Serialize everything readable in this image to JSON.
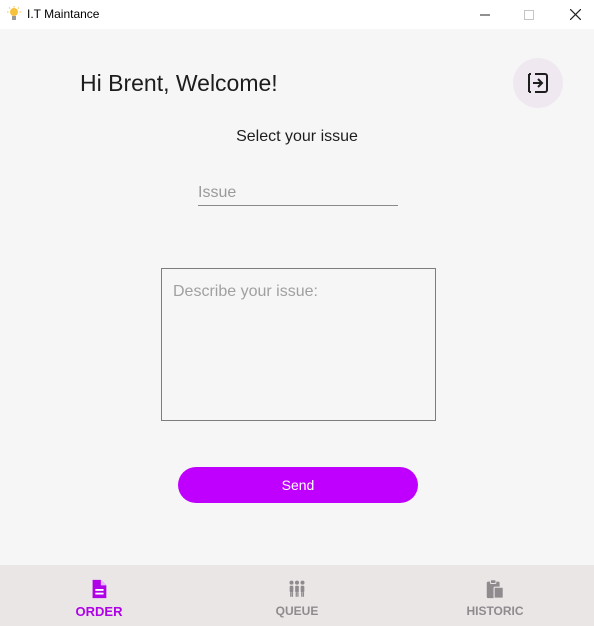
{
  "window": {
    "title": "I.T Maintance",
    "minimize_glyph": "—",
    "maximize_glyph": "☐",
    "close_glyph": "✕"
  },
  "header": {
    "greeting": "Hi Brent, Welcome!",
    "logout_icon": "logout-icon"
  },
  "form": {
    "select_label": "Select your issue",
    "issue_placeholder": "Issue",
    "description_placeholder": "Describe your issue:",
    "send_label": "Send"
  },
  "bottom_nav": {
    "items": [
      {
        "label": "ORDER",
        "icon": "document-icon",
        "active": true
      },
      {
        "label": "QUEUE",
        "icon": "people-queue-icon",
        "active": false
      },
      {
        "label": "HISTORIC",
        "icon": "clipboard-icon",
        "active": false
      }
    ]
  },
  "colors": {
    "accent": "#c000ff",
    "active_nav": "#b000e8",
    "inactive_nav": "#8f8a8e",
    "background": "#f7f6f6",
    "nav_background": "#ebe6e6"
  }
}
